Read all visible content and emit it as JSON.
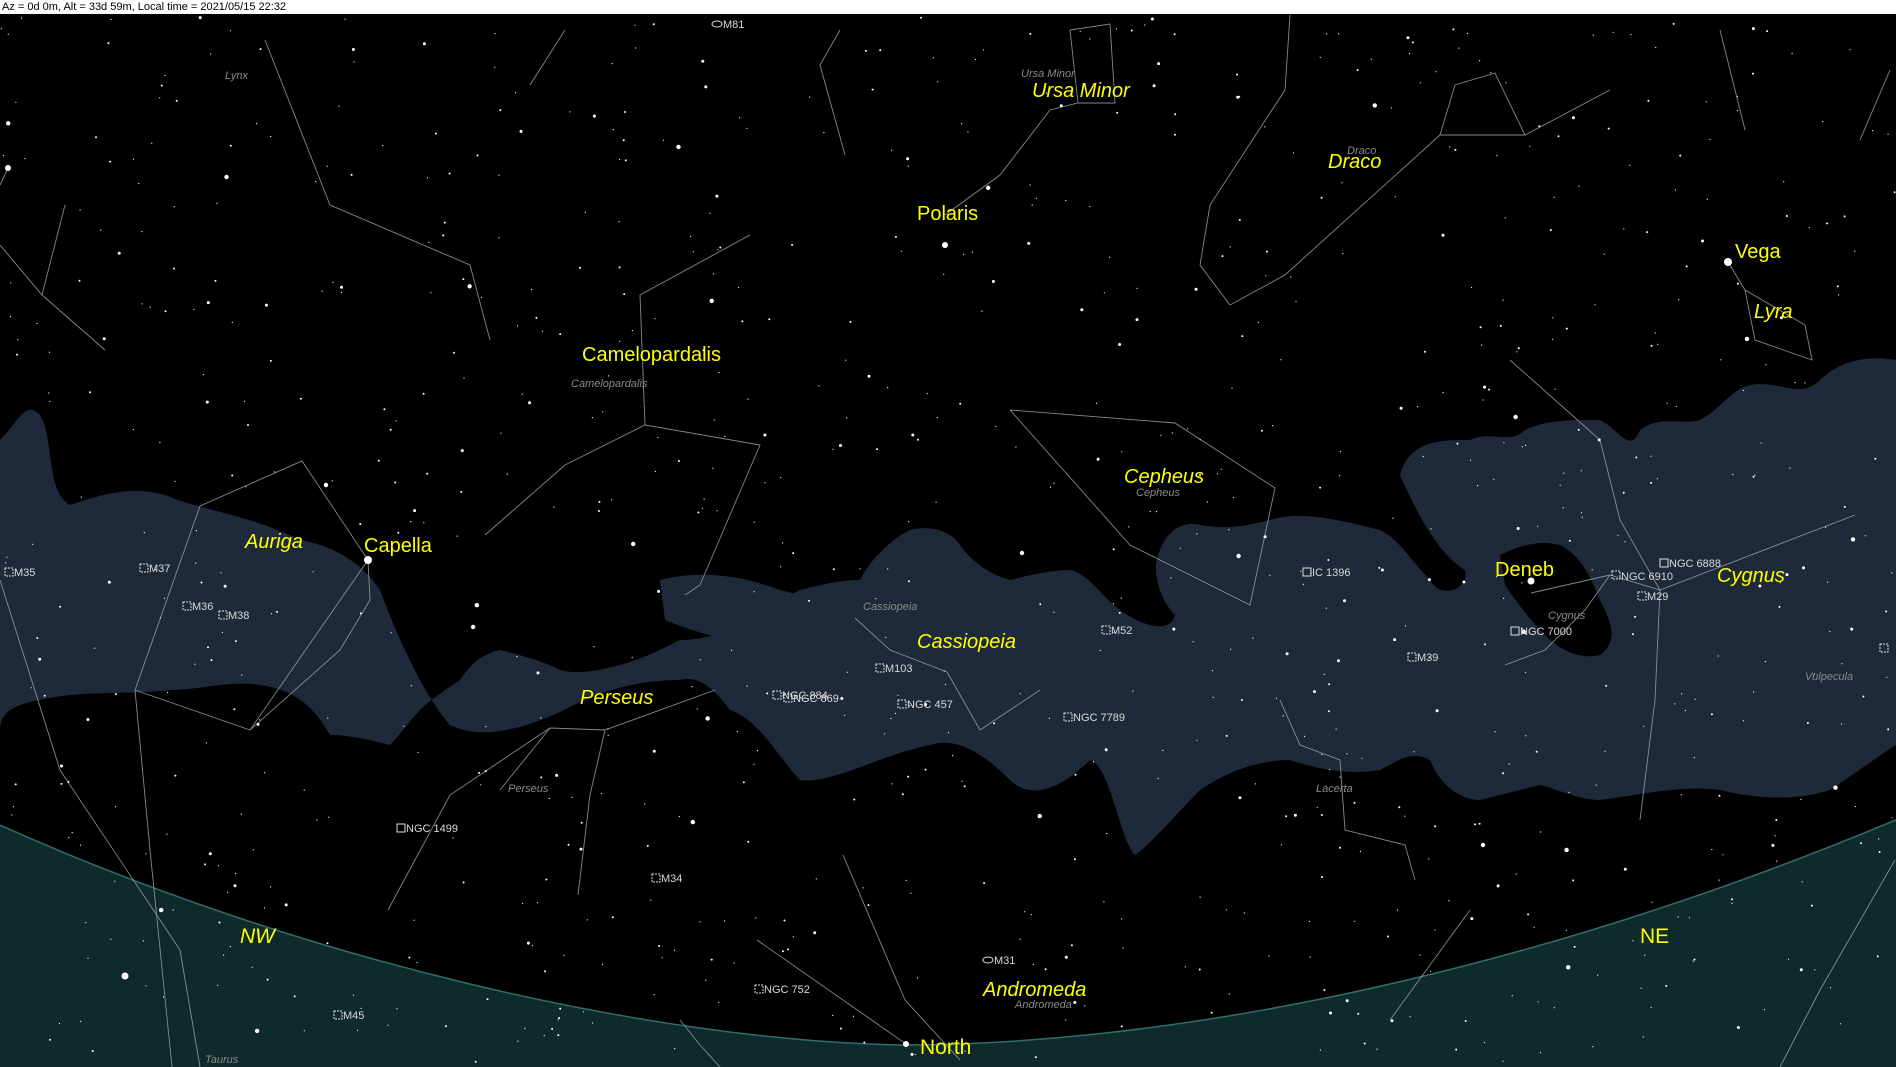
{
  "status": {
    "text": "Az = 0d 0m, Alt = 33d 59m, Local time = 2021/05/15 22:32"
  },
  "colors": {
    "sky": "#000000",
    "milky_way": "#1e2a3a",
    "horizon": "#0f2a2a",
    "constellation_line": "#9aa0a8",
    "label": "#ffff00"
  },
  "labels": {
    "stars": {
      "polaris": "Polaris",
      "capella": "Capella",
      "vega": "Vega",
      "deneb": "Deneb"
    },
    "constellations": {
      "camelopardalis": "Camelopardalis",
      "ursa_minor": "Ursa Minor",
      "draco": "Draco",
      "lyra": "Lyra",
      "cepheus": "Cepheus",
      "auriga": "Auriga",
      "cassiopeia": "Cassiopeia",
      "perseus": "Perseus",
      "cygnus": "Cygnus",
      "andromeda": "Andromeda"
    },
    "constellations_small": {
      "lynx": "Lynx",
      "ursa_minor": "Ursa Minor",
      "draco": "Draco",
      "camelopardalis": "Camelopardalis",
      "cepheus": "Cepheus",
      "cassiopeia": "Cassiopeia",
      "perseus": "Perseus",
      "lacerta": "Lacerta",
      "cygnus": "Cygnus",
      "andromeda": "Andromeda",
      "taurus": "Taurus",
      "vulpecula": "Vulpecula"
    },
    "directions": {
      "nw": "NW",
      "north": "North",
      "ne": "NE"
    },
    "dso": {
      "m81": "M81",
      "m35": "M35",
      "m37": "M37",
      "m36": "M36",
      "m38": "M38",
      "ic1396": "IC 1396",
      "ngc6888": "NGC 6888",
      "ngc6910": "NGC 6910",
      "m29": "M29",
      "ngc7000": "NGC 7000",
      "m39": "M39",
      "m52": "M52",
      "m103": "M103",
      "ngc884": "NGC 884",
      "ngc869": "NGC 869",
      "ngc457": "NGC 457",
      "ngc7789": "NGC 7789",
      "ngc1499": "NGC 1499",
      "m34": "M34",
      "m31": "M31",
      "ngc752": "NGC 752",
      "m45": "M45"
    }
  }
}
